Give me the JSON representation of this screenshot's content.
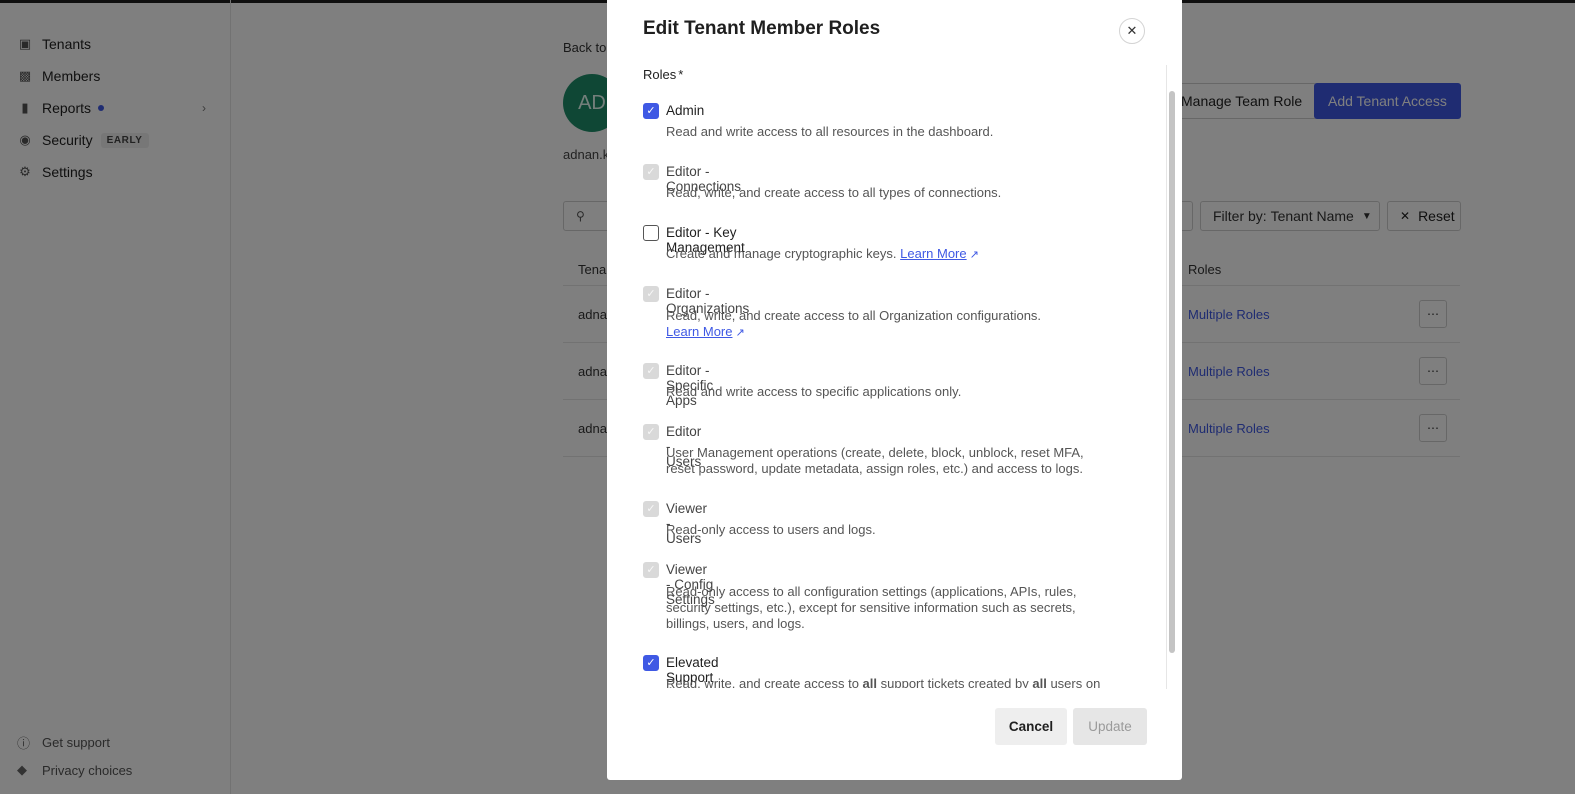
{
  "sidebar": {
    "items": [
      {
        "label": "Tenants",
        "icon": "cube-icon"
      },
      {
        "label": "Members",
        "icon": "users-icon"
      },
      {
        "label": "Reports",
        "icon": "bar-chart-icon"
      },
      {
        "label": "Security",
        "icon": "shield-icon",
        "badge": "EARLY"
      },
      {
        "label": "Settings",
        "icon": "gear-icon"
      }
    ],
    "footer": [
      {
        "label": "Get support",
        "icon": "help-icon"
      },
      {
        "label": "Privacy choices",
        "icon": "lock-icon"
      }
    ]
  },
  "page": {
    "back": "Back to",
    "avatar": "AD",
    "email": "adnan.k",
    "manage_team_role": "Manage Team Role",
    "add_tenant_access": "Add Tenant Access",
    "filter_prefix": "Filter by:",
    "filter_value": "Tenant Name",
    "reset": "Reset",
    "table": {
      "headers": [
        "Tena",
        "Roles"
      ],
      "rows": [
        {
          "tenant": "adna",
          "roles": "Multiple Roles"
        },
        {
          "tenant": "adna",
          "roles": "Multiple Roles"
        },
        {
          "tenant": "adna",
          "roles": "Multiple Roles"
        }
      ]
    }
  },
  "modal": {
    "title": "Edit Tenant Member Roles",
    "roles_label": "Roles",
    "required_mark": "*",
    "learn_more": "Learn More",
    "roles": [
      {
        "name": "Admin",
        "state": "checked",
        "desc": "Read and write access to all resources in the dashboard."
      },
      {
        "name": "Editor - Connections",
        "state": "disabled",
        "desc": "Read, write, and create access to all types of connections."
      },
      {
        "name": "Editor - Key Management",
        "state": "unchecked",
        "desc": "Create and manage cryptographic keys."
      },
      {
        "name": "Editor - Organizations",
        "state": "disabled",
        "desc": "Read, write, and create access to all Organization configurations."
      },
      {
        "name": "Editor - Specific Apps",
        "state": "disabled",
        "desc": "Read and write access to specific applications only."
      },
      {
        "name": "Editor - Users",
        "state": "disabled",
        "desc": "User Management operations (create, delete, block, unblock, reset MFA, reset password, update metadata, assign roles, etc.) and access to logs."
      },
      {
        "name": "Viewer - Users",
        "state": "disabled",
        "desc": "Read-only access to users and logs."
      },
      {
        "name": "Viewer - Config Settings",
        "state": "disabled",
        "desc": "Read-only access to all configuration settings (applications, APIs, rules, security settings, etc.), except for sensitive information such as secrets, billings, users, and logs."
      },
      {
        "name": "Elevated Support Access",
        "state": "checked",
        "desc_parts": [
          "Read, write, and create access to ",
          "all",
          " support tickets created by ",
          "all",
          " users on"
        ]
      }
    ],
    "cancel": "Cancel",
    "update": "Update"
  }
}
